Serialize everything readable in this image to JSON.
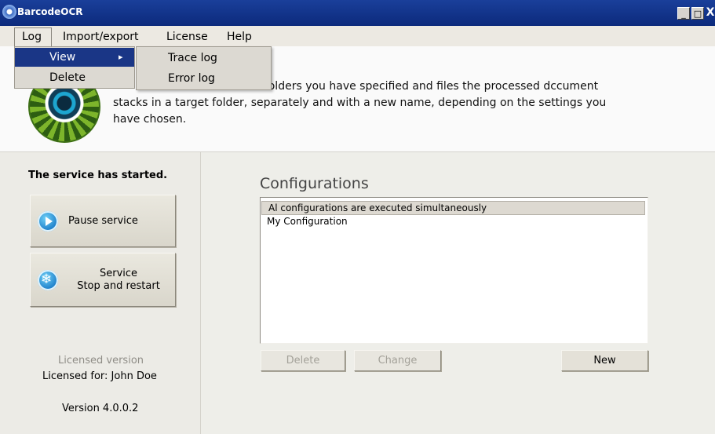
{
  "window": {
    "title": "BarcodeOCR",
    "minimize": "_",
    "maximize": "□",
    "close": "X"
  },
  "menubar": {
    "items": [
      "Log",
      "Import/export",
      "License",
      "Help"
    ]
  },
  "log_menu": {
    "items": [
      "View",
      "Delete"
    ],
    "view_arrow": "▸"
  },
  "view_submenu": {
    "items": [
      "Trace log",
      "Error log"
    ]
  },
  "description": {
    "line1": "ut folders you have specified and files the processed dccument",
    "line2": "stacks in a target folder, separately and with a new name, depending on the settings you",
    "line3": "have chosen."
  },
  "service": {
    "status": "The service has started.",
    "pause_label": "Pause service",
    "restart_line1": "Service",
    "restart_line2": "Stop and restart"
  },
  "license": {
    "version_type": "Licensed version",
    "licensed_for": "Licensed for: John Doe",
    "version": "Version 4.0.0.2"
  },
  "configurations": {
    "title": "Configurations",
    "items": [
      "Al configurations are executed simultaneously",
      "My Configuration"
    ],
    "delete_label": "Delete",
    "change_label": "Change",
    "new_label": "New"
  }
}
